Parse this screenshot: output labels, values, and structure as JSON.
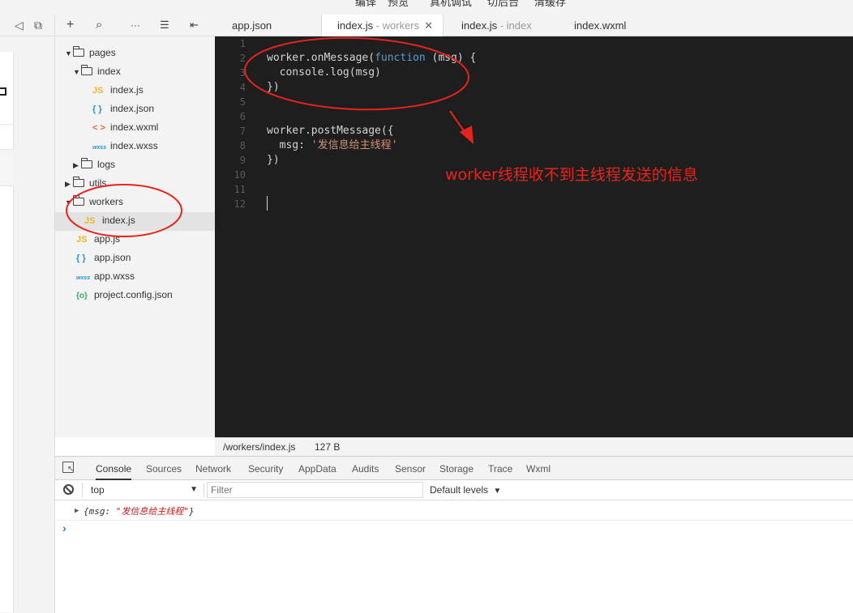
{
  "menu": [
    "编译",
    "预览",
    "真机调试",
    "切后台",
    "清缓存"
  ],
  "tree": {
    "items": [
      {
        "label": "pages",
        "type": "folder",
        "expanded": true
      },
      {
        "label": "index",
        "type": "folder",
        "expanded": true
      },
      {
        "label": "index.js",
        "type": "js",
        "icon": "JS"
      },
      {
        "label": "index.json",
        "type": "json",
        "icon": "{ }"
      },
      {
        "label": "index.wxml",
        "type": "wxml",
        "icon": "< >"
      },
      {
        "label": "index.wxss",
        "type": "wxss",
        "icon": "wxss"
      },
      {
        "label": "logs",
        "type": "folder",
        "expanded": false
      },
      {
        "label": "utils",
        "type": "folder",
        "expanded": false
      },
      {
        "label": "workers",
        "type": "folder",
        "expanded": true
      },
      {
        "label": "index.js",
        "type": "js",
        "icon": "JS"
      },
      {
        "label": "app.js",
        "type": "js",
        "icon": "JS"
      },
      {
        "label": "app.json",
        "type": "json",
        "icon": "{ }"
      },
      {
        "label": "app.wxss",
        "type": "wxss",
        "icon": "wxss"
      },
      {
        "label": "project.config.json",
        "type": "cfg",
        "icon": "{o}"
      }
    ]
  },
  "tabs": [
    {
      "name": "app.json",
      "sub": ""
    },
    {
      "name": "index.js",
      "sub": " - workers",
      "close": "✕"
    },
    {
      "name": "index.js",
      "sub": " - index"
    },
    {
      "name": "index.wxml",
      "sub": ""
    }
  ],
  "editor": {
    "line_numbers": [
      "1",
      "2",
      "3",
      "4",
      "5",
      "6",
      "7",
      "8",
      "9",
      "10",
      "11",
      "12"
    ],
    "code": {
      "l2_a": "worker.onMessage(",
      "l2_kw": "function",
      "l2_b": " (msg) {",
      "l3": "  console.log(msg)",
      "l4": "})",
      "l7": "worker.postMessage({",
      "l8_a": "  msg: ",
      "l8_str": "'发信息给主线程'",
      "l9": "})"
    }
  },
  "status": {
    "path": "/workers/index.js",
    "size": "127 B"
  },
  "devtools": {
    "tabs": [
      "Console",
      "Sources",
      "Network",
      "Security",
      "AppData",
      "Audits",
      "Sensor",
      "Storage",
      "Trace",
      "Wxml"
    ],
    "context": "top",
    "filter_placeholder": "Filter",
    "levels": "Default levels",
    "log": {
      "prefix": "{msg: ",
      "value": "\"发信息给主线程\"",
      "suffix": "}"
    },
    "prompt": "›"
  },
  "annotation": {
    "text": "worker线程收不到主线程发送的信息",
    "color": "#e8231d"
  }
}
